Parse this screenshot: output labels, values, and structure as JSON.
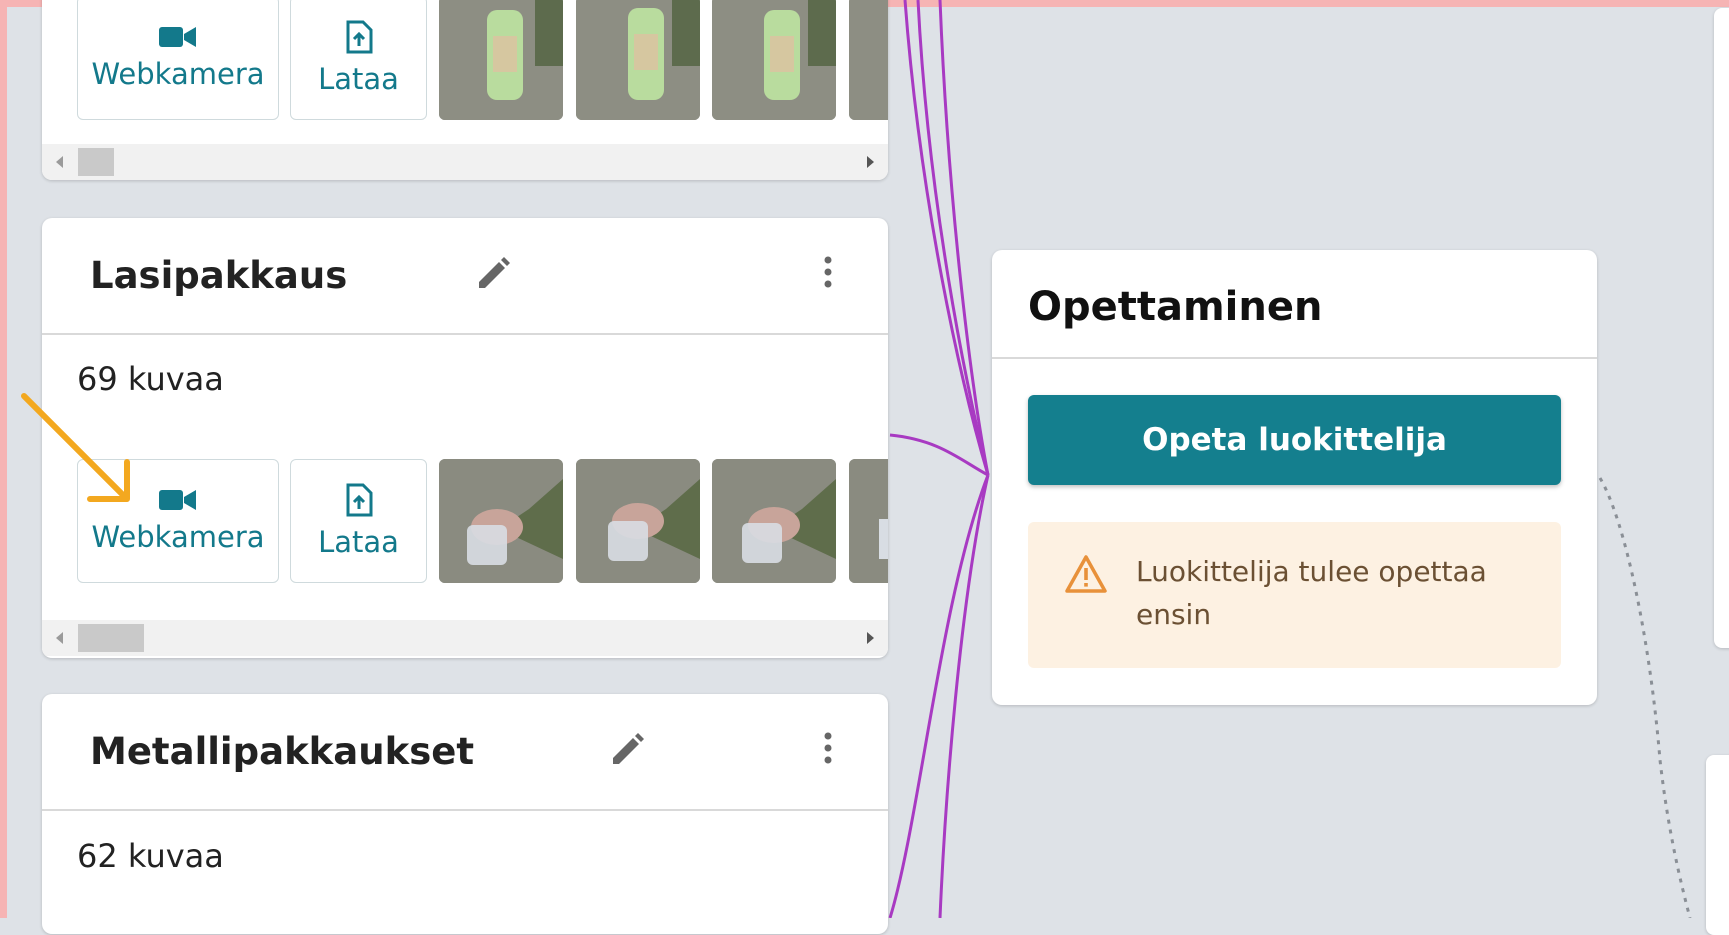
{
  "top_card": {
    "webcam_label": "Webkamera",
    "upload_label": "Lataa"
  },
  "glass_card": {
    "title": "Lasipakkaus",
    "count": "69 kuvaa",
    "webcam_label": "Webkamera",
    "upload_label": "Lataa"
  },
  "metal_card": {
    "title": "Metallipakkaukset",
    "count": "62 kuvaa"
  },
  "training": {
    "title": "Opettaminen",
    "train_button": "Opeta luokittelija",
    "warning": "Luokittelija tulee opettaa ensin"
  },
  "colors": {
    "accent": "#147f8e",
    "connector": "#a83ac2",
    "annotation_arrow": "#f3a81f",
    "warning_bg": "#fdf1e2"
  }
}
